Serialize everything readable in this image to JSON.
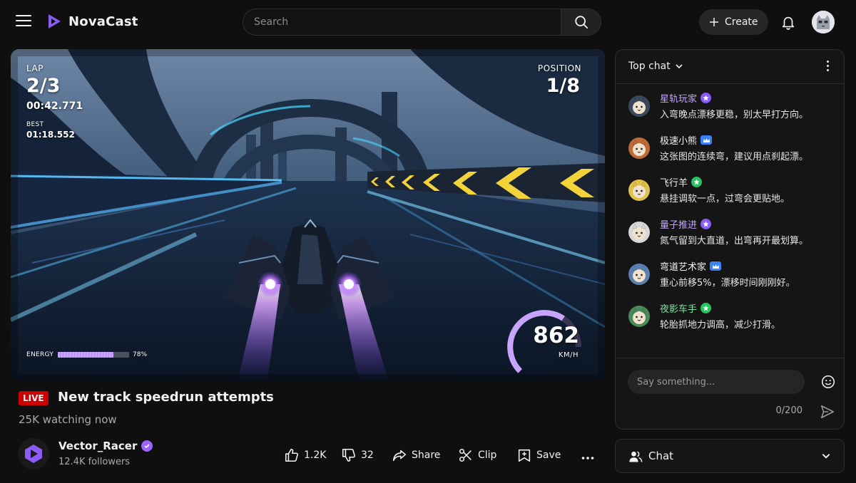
{
  "app": {
    "name": "NovaCast",
    "accent": "#9a64ff"
  },
  "search": {
    "placeholder": "Search"
  },
  "header": {
    "create_label": "Create"
  },
  "hud": {
    "lap_label": "LAP",
    "lap": "2/3",
    "lap_time": "00:42.771",
    "best_label": "BEST",
    "best_time": "01:18.552",
    "position_label": "POSITION",
    "position": "1/8",
    "energy_label": "ENERGY",
    "energy_pct_text": "78%",
    "energy_fraction": 0.78,
    "speed": "862",
    "speed_unit": "KM/H",
    "speed_gauge_fraction": 0.75
  },
  "stream": {
    "live_label": "LIVE",
    "title": "New track speedrun attempts",
    "watching": "25K watching now"
  },
  "channel": {
    "name": "Vector_Racer",
    "followers": "12.4K followers"
  },
  "actions": {
    "like_count": "1.2K",
    "dislike_count": "32",
    "share_label": "Share",
    "clip_label": "Clip",
    "save_label": "Save"
  },
  "chat": {
    "title": "Top chat",
    "messages": [
      {
        "user": "星轨玩家",
        "text": "入弯晚点漂移更稳，别太早打方向。",
        "name_color": "#c4a3ff",
        "badge": "star",
        "badge_color": "#8b5cf6",
        "avatar_bg": "#3a4a5c"
      },
      {
        "user": "极速小熊",
        "text": "这张图的连续弯，建议用点刹起漂。",
        "name_color": "#f1f1f1",
        "badge": "crown",
        "badge_color": "#3b82f6",
        "avatar_bg": "#c06a3a"
      },
      {
        "user": "飞行羊",
        "text": "悬挂调软一点，过弯会更贴地。",
        "name_color": "#f1f1f1",
        "badge": "star",
        "badge_color": "#22c55e",
        "avatar_bg": "#e0c24a"
      },
      {
        "user": "量子推进",
        "text": "氮气留到大直道，出弯再开最划算。",
        "name_color": "#c4a3ff",
        "badge": "star",
        "badge_color": "#8b5cf6",
        "avatar_bg": "#d8d8d8"
      },
      {
        "user": "弯道艺术家",
        "text": "重心前移5%，漂移时间刚刚好。",
        "name_color": "#f1f1f1",
        "badge": "crown",
        "badge_color": "#3b82f6",
        "avatar_bg": "#5a7fb0"
      },
      {
        "user": "夜影车手",
        "text": "轮胎抓地力调高，减少打滑。",
        "name_color": "#7fe0a0",
        "badge": "star",
        "badge_color": "#22c55e",
        "avatar_bg": "#4a8a5a"
      }
    ],
    "input_placeholder": "Say something...",
    "char_count": "0/200",
    "toggle_label": "Chat"
  }
}
